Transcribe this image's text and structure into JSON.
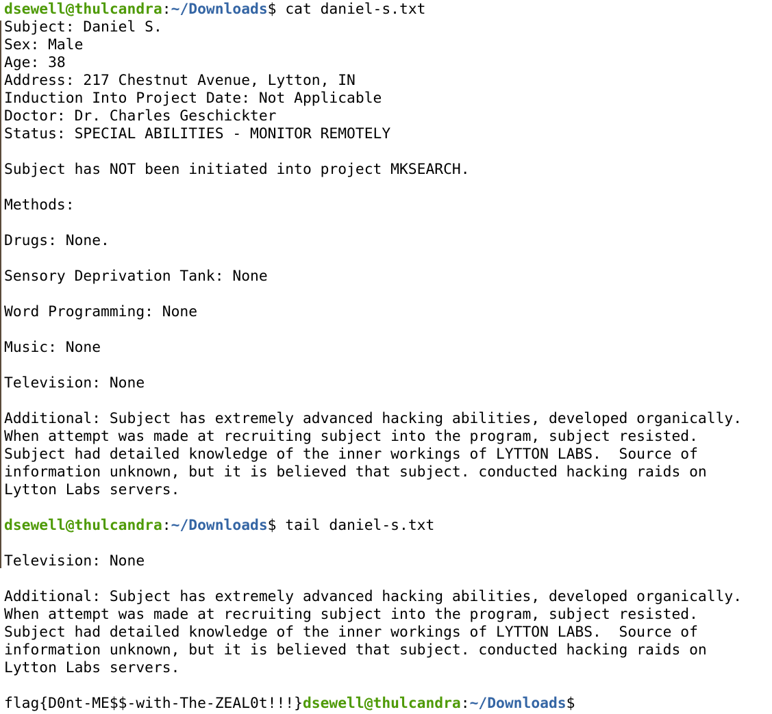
{
  "prompt": {
    "user_host": "dsewell@thulcandra",
    "sep": ":",
    "path": "~/Downloads",
    "symbol": "$"
  },
  "commands": {
    "cmd1": " cat daniel-s.txt",
    "cmd2": " tail daniel-s.txt"
  },
  "cat_output": [
    "Subject: Daniel S.",
    "Sex: Male",
    "Age: 38",
    "Address: 217 Chestnut Avenue, Lytton, IN",
    "Induction Into Project Date: Not Applicable",
    "Doctor: Dr. Charles Geschickter",
    "Status: SPECIAL ABILITIES - MONITOR REMOTELY",
    "",
    "Subject has NOT been initiated into project MKSEARCH.",
    "",
    "Methods:",
    "",
    "Drugs: None.",
    "",
    "Sensory Deprivation Tank: None",
    "",
    "Word Programming: None",
    "",
    "Music: None",
    "",
    "Television: None",
    "",
    "Additional: Subject has extremely advanced hacking abilities, developed organically.",
    "When attempt was made at recruiting subject into the program, subject resisted.",
    "Subject had detailed knowledge of the inner workings of LYTTON LABS.  Source of",
    "information unknown, but it is believed that subject. conducted hacking raids on",
    "Lytton Labs servers.",
    ""
  ],
  "tail_output": [
    "",
    "Television: None",
    "",
    "Additional: Subject has extremely advanced hacking abilities, developed organically.",
    "When attempt was made at recruiting subject into the program, subject resisted.",
    "Subject had detailed knowledge of the inner workings of LYTTON LABS.  Source of",
    "information unknown, but it is believed that subject. conducted hacking raids on",
    "Lytton Labs servers.",
    ""
  ],
  "flag_text": "flag{D0nt-ME$$-with-The-ZEAL0t!!!}",
  "colors": {
    "user_host": "#4e9a06",
    "path": "#3465a4",
    "text": "#000000",
    "background": "#ffffff"
  }
}
